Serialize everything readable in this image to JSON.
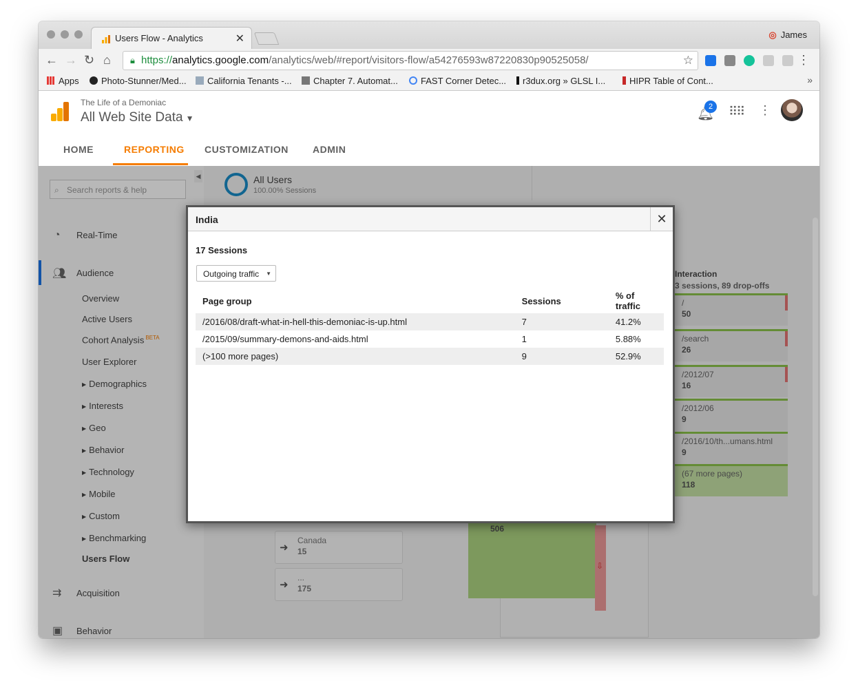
{
  "browser": {
    "tab_title": "Users Flow - Analytics",
    "profile_name": "James",
    "url_scheme": "https://",
    "url_host": "analytics.google.com",
    "url_path": "/analytics/web/#report/visitors-flow/a54276593w87220830p90525058/",
    "bookmarks": [
      "Apps",
      "Photo-Stunner/Med...",
      "California Tenants -...",
      "Chapter 7. Automat...",
      "FAST Corner Detec...",
      "r3dux.org » GLSL I...",
      "HIPR Table of Cont..."
    ]
  },
  "ga": {
    "account": "The Life of a Demoniac",
    "property": "All Web Site Data",
    "notification_count": "2",
    "nav_tabs": [
      "HOME",
      "REPORTING",
      "CUSTOMIZATION",
      "ADMIN"
    ],
    "search_placeholder": "Search reports & help",
    "realtime_label": "Real-Time",
    "audience_label": "Audience",
    "audience_items": [
      "Overview",
      "Active Users",
      "Cohort Analysis",
      "User Explorer"
    ],
    "beta_label": "BETA",
    "audience_groups": [
      "Demographics",
      "Interests",
      "Geo",
      "Behavior",
      "Technology",
      "Mobile",
      "Custom",
      "Benchmarking"
    ],
    "users_flow_label": "Users Flow",
    "acquisition_label": "Acquisition",
    "behavior_label": "Behavior"
  },
  "segment": {
    "name": "All Users",
    "sub": "100.00% Sessions"
  },
  "flow": {
    "interaction_title": "Interaction",
    "interaction_sub": "3 sessions, 89 drop-offs",
    "nodes": [
      {
        "name": "/",
        "count": "50"
      },
      {
        "name": "/search",
        "count": "26"
      },
      {
        "name": "/2012/07",
        "count": "16"
      },
      {
        "name": "/2012/06",
        "count": "9"
      },
      {
        "name": "/2016/10/th...umans.html",
        "count": "9"
      },
      {
        "name": "(67 more pages)",
        "count": "118"
      }
    ],
    "sources": [
      {
        "name": "Canada",
        "count": "15"
      },
      {
        "name": "...",
        "count": "175"
      }
    ],
    "big_node_count": "506"
  },
  "modal": {
    "title": "India",
    "sessions": "17 Sessions",
    "dropdown": "Outgoing traffic",
    "headers": [
      "Page group",
      "Sessions",
      "% of traffic"
    ],
    "rows": [
      [
        "/2016/08/draft-what-in-hell-this-demoniac-is-up.html",
        "7",
        "41.2%"
      ],
      [
        "/2015/09/summary-demons-and-aids.html",
        "1",
        "5.88%"
      ],
      [
        "(>100 more pages)",
        "9",
        "52.9%"
      ]
    ]
  }
}
